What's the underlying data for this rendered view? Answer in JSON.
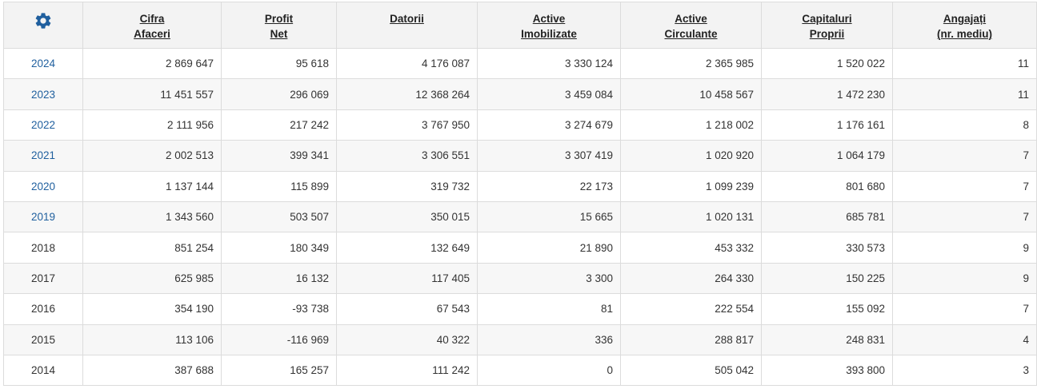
{
  "settings_icon": "gear-icon",
  "accent_color": "#1f5f9e",
  "columns": [
    {
      "line1": "Cifra",
      "line2": "Afaceri"
    },
    {
      "line1": "Profit",
      "line2": "Net"
    },
    {
      "line1": "Datorii",
      "line2": ""
    },
    {
      "line1": "Active",
      "line2": "Imobilizate"
    },
    {
      "line1": "Active",
      "line2": "Circulante"
    },
    {
      "line1": "Capitaluri",
      "line2": "Proprii"
    },
    {
      "line1": "Angajați",
      "line2": "(nr. mediu)"
    }
  ],
  "rows": [
    {
      "year": "2024",
      "link": true,
      "values": [
        "2 869 647",
        "95 618",
        "4 176 087",
        "3 330 124",
        "2 365 985",
        "1 520 022",
        "11"
      ]
    },
    {
      "year": "2023",
      "link": true,
      "values": [
        "11 451 557",
        "296 069",
        "12 368 264",
        "3 459 084",
        "10 458 567",
        "1 472 230",
        "11"
      ]
    },
    {
      "year": "2022",
      "link": true,
      "values": [
        "2 111 956",
        "217 242",
        "3 767 950",
        "3 274 679",
        "1 218 002",
        "1 176 161",
        "8"
      ]
    },
    {
      "year": "2021",
      "link": true,
      "values": [
        "2 002 513",
        "399 341",
        "3 306 551",
        "3 307 419",
        "1 020 920",
        "1 064 179",
        "7"
      ]
    },
    {
      "year": "2020",
      "link": true,
      "values": [
        "1 137 144",
        "115 899",
        "319 732",
        "22 173",
        "1 099 239",
        "801 680",
        "7"
      ]
    },
    {
      "year": "2019",
      "link": true,
      "values": [
        "1 343 560",
        "503 507",
        "350 015",
        "15 665",
        "1 020 131",
        "685 781",
        "7"
      ]
    },
    {
      "year": "2018",
      "link": false,
      "values": [
        "851 254",
        "180 349",
        "132 649",
        "21 890",
        "453 332",
        "330 573",
        "9"
      ]
    },
    {
      "year": "2017",
      "link": false,
      "values": [
        "625 985",
        "16 132",
        "117 405",
        "3 300",
        "264 330",
        "150 225",
        "9"
      ]
    },
    {
      "year": "2016",
      "link": false,
      "values": [
        "354 190",
        "-93 738",
        "67 543",
        "81",
        "222 554",
        "155 092",
        "7"
      ]
    },
    {
      "year": "2015",
      "link": false,
      "values": [
        "113 106",
        "-116 969",
        "40 322",
        "336",
        "288 817",
        "248 831",
        "4"
      ]
    },
    {
      "year": "2014",
      "link": false,
      "values": [
        "387 688",
        "165 257",
        "111 242",
        "0",
        "505 042",
        "393 800",
        "3"
      ]
    }
  ]
}
